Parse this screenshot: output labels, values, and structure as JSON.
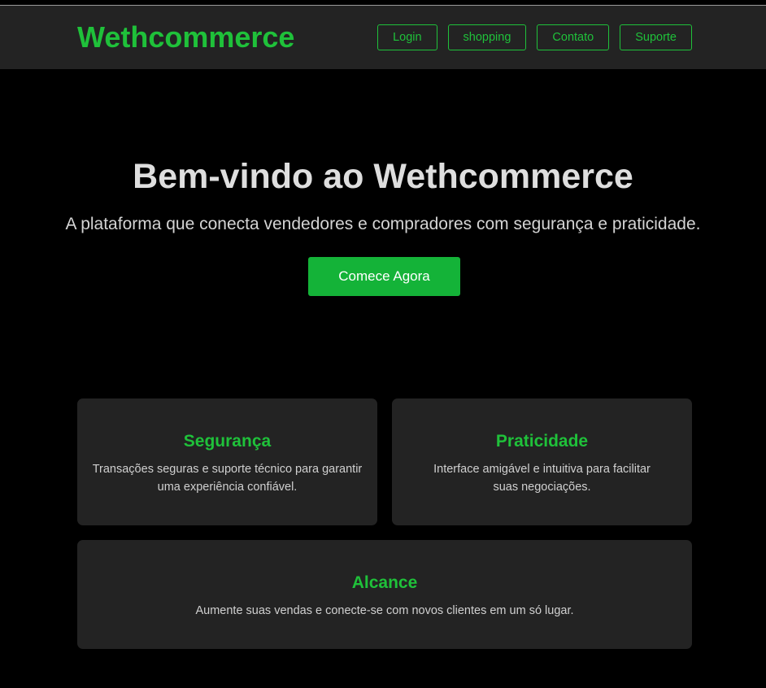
{
  "header": {
    "brand": "Wethcommerce",
    "nav": [
      {
        "label": "Login"
      },
      {
        "label": "shopping"
      },
      {
        "label": "Contato"
      },
      {
        "label": "Suporte"
      }
    ]
  },
  "hero": {
    "title": "Bem-vindo ao Wethcommerce",
    "subtitle": "A plataforma que conecta vendedores e compradores com segurança e praticidade.",
    "cta_label": "Comece Agora"
  },
  "features": [
    {
      "title": "Segurança",
      "text": "Transações seguras e suporte técnico para garantir uma experiência confiável."
    },
    {
      "title": "Praticidade",
      "text": "Interface amigável e intuitiva para facilitar suas negociações."
    },
    {
      "title": "Alcance",
      "text": "Aumente suas vendas e conecte-se com novos clientes em um só lugar."
    }
  ],
  "colors": {
    "accent": "#1fc13a",
    "cta_background": "#14b338",
    "header_background": "#232323",
    "page_background": "#000000",
    "card_background": "#232323"
  }
}
